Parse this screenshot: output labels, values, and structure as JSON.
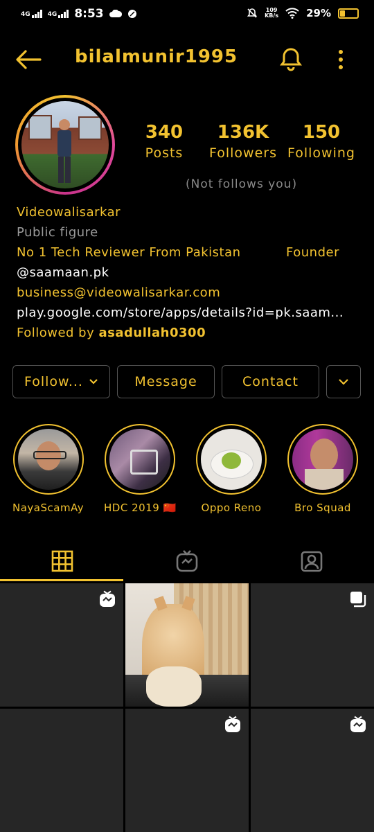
{
  "status": {
    "network1": "4G",
    "network2": "4G",
    "time": "8:53",
    "speed_top": "109",
    "speed_bottom": "KB/s",
    "battery": "29%"
  },
  "header": {
    "username": "bilalmunir1995"
  },
  "stats": [
    {
      "value": "340",
      "label": "Posts"
    },
    {
      "value": "136K",
      "label": "Followers"
    },
    {
      "value": "150",
      "label": "Following"
    }
  ],
  "not_follows": "(Not follows you)",
  "bio": {
    "name": "Videowalisarkar",
    "category": "Public figure",
    "line1_left": "No 1 Tech Reviewer From Pakistan",
    "line1_right": "Founder",
    "handle": "@saamaan.pk",
    "email": "business@videowalisarkar.com",
    "link": "play.google.com/store/apps/details?id=pk.saam...",
    "followed_prefix": "Followed by ",
    "followed_user": "asadullah0300"
  },
  "buttons": {
    "follow": "Follow...",
    "message": "Message",
    "contact": "Contact"
  },
  "highlights": [
    {
      "label": "NayaScamAya..."
    },
    {
      "label": "HDC 2019 🇨🇳"
    },
    {
      "label": "Oppo Reno"
    },
    {
      "label": "Bro Squad"
    }
  ],
  "tabs": [
    "grid-icon",
    "igtv-icon",
    "tagged-icon"
  ],
  "colors": {
    "accent": "#f2c230",
    "background": "#000000",
    "muted": "#9a9a9a"
  }
}
